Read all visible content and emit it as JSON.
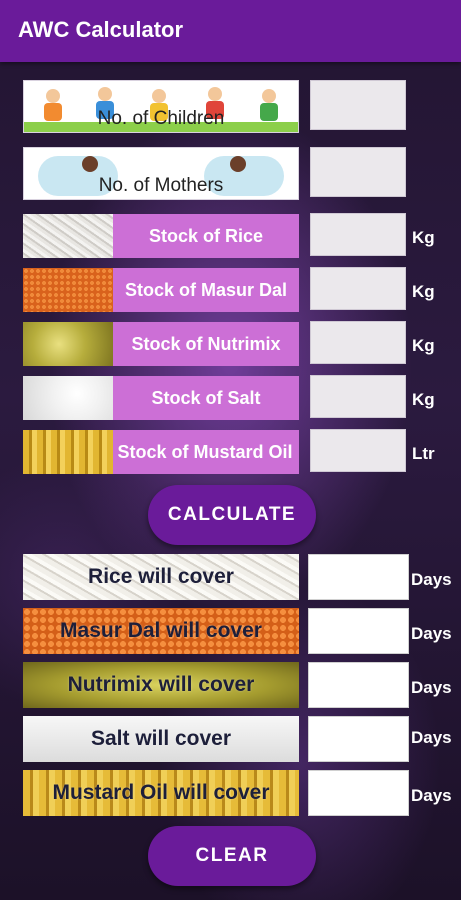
{
  "app": {
    "title": "AWC Calculator"
  },
  "inputs": {
    "children": {
      "label": "No. of Children",
      "value": ""
    },
    "mothers": {
      "label": "No. of Mothers",
      "value": ""
    },
    "stocks": [
      {
        "label": "Stock of Rice",
        "unit": "Kg",
        "value": ""
      },
      {
        "label": "Stock of Masur Dal",
        "unit": "Kg",
        "value": ""
      },
      {
        "label": "Stock of Nutrimix",
        "unit": "Kg",
        "value": ""
      },
      {
        "label": "Stock of Salt",
        "unit": "Kg",
        "value": ""
      },
      {
        "label": "Stock of Mustard Oil",
        "unit": "Ltr",
        "value": ""
      }
    ]
  },
  "buttons": {
    "calculate": "CALCULATE",
    "clear": "CLEAR"
  },
  "results": [
    {
      "label": "Rice will cover",
      "unit": "Days",
      "value": ""
    },
    {
      "label": "Masur Dal will cover",
      "unit": "Days",
      "value": ""
    },
    {
      "label": "Nutrimix will cover",
      "unit": "Days",
      "value": ""
    },
    {
      "label": "Salt will cover",
      "unit": "Days",
      "value": ""
    },
    {
      "label": "Mustard Oil will cover",
      "unit": "Days",
      "value": ""
    }
  ],
  "colors": {
    "primary": "#6a1b9a",
    "stock_label_bg": "#cc6fd6",
    "text_on_primary": "#ffffff"
  }
}
